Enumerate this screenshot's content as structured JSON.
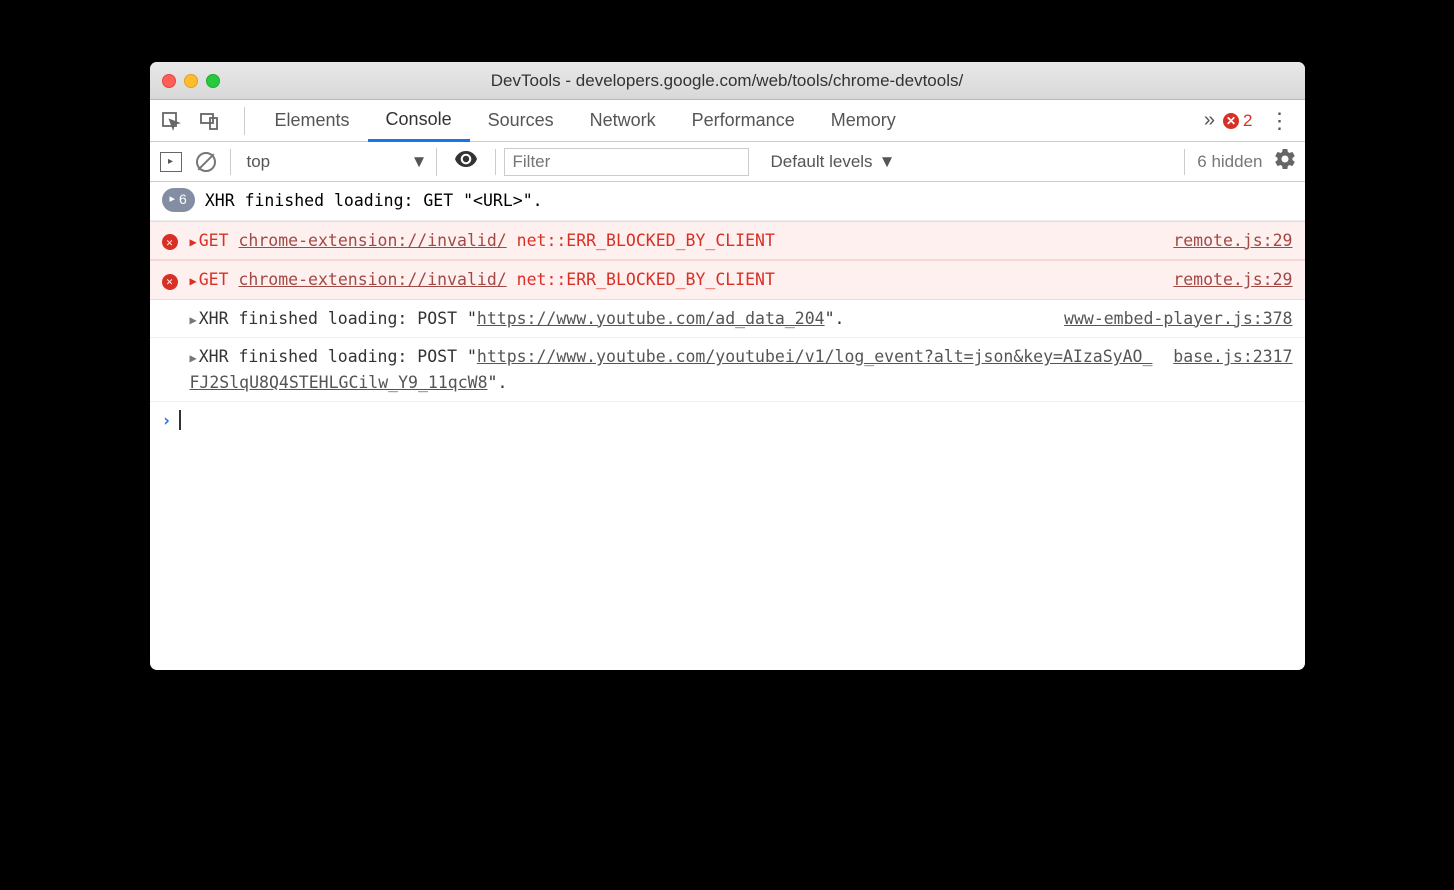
{
  "window": {
    "title": "DevTools - developers.google.com/web/tools/chrome-devtools/"
  },
  "tabs": {
    "items": [
      "Elements",
      "Console",
      "Sources",
      "Network",
      "Performance",
      "Memory"
    ],
    "active_index": 1,
    "error_count": "2"
  },
  "toolbar": {
    "context": "top",
    "filter_placeholder": "Filter",
    "levels": "Default levels",
    "hidden": "6 hidden"
  },
  "logs": {
    "row0": {
      "count": "6",
      "msg": "XHR finished loading: GET \"<URL>\"."
    },
    "row1": {
      "method": "GET",
      "url": "chrome-extension://invalid/",
      "err": "net::ERR_BLOCKED_BY_CLIENT",
      "src": "remote.js:29"
    },
    "row2": {
      "method": "GET",
      "url": "chrome-extension://invalid/",
      "err": "net::ERR_BLOCKED_BY_CLIENT",
      "src": "remote.js:29"
    },
    "row3": {
      "prefix": "XHR finished loading: POST \"",
      "url": "https://www.youtube.com/ad_data_204",
      "suffix": "\".",
      "src": "www-embed-player.js:378"
    },
    "row4": {
      "prefix": "XHR finished loading: POST \"",
      "url": "https://www.youtube.com/youtubei/v1/log_event?alt=json&key=AIzaSyAO_FJ2SlqU8Q4STEHLGCilw_Y9_11qcW8",
      "suffix": "\".",
      "src": "base.js:2317"
    }
  }
}
